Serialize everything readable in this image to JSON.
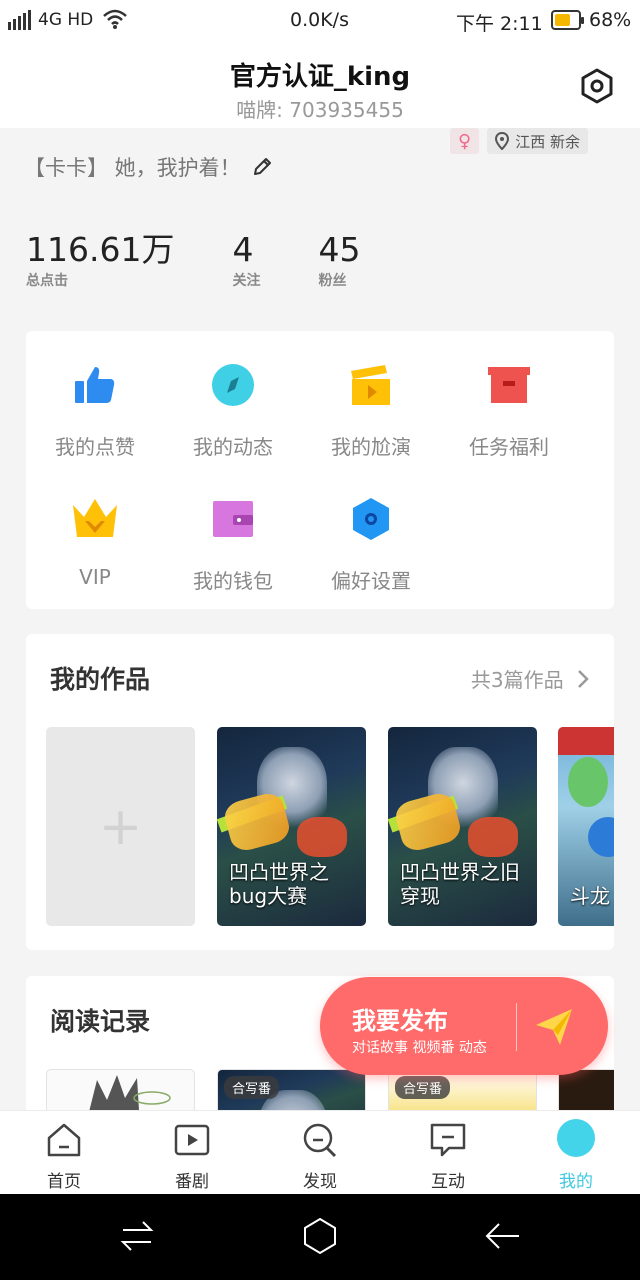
{
  "status_bar": {
    "network": "4G HD",
    "speed": "0.0K/s",
    "time": "下午 2:11",
    "battery_percent": "68%",
    "battery_level": 0.68,
    "battery_color": "#f5b800"
  },
  "header": {
    "name": "官方认证_king",
    "id_label": "喵牌: 703935455",
    "settings_icon": "hexagon-gear-icon"
  },
  "profile": {
    "gender_symbol": "♀",
    "location": "江西 新余",
    "bio": "【卡卡】 她，我护着！",
    "stats": [
      {
        "value": "116.61万",
        "label": "总点击"
      },
      {
        "value": "4",
        "label": "关注"
      },
      {
        "value": "45",
        "label": "粉丝"
      }
    ]
  },
  "menu": [
    {
      "label": "我的点赞",
      "icon": "thumbs-up-icon",
      "color": "#2e8cf0"
    },
    {
      "label": "我的动态",
      "icon": "compass-icon",
      "color": "#3fd0e6"
    },
    {
      "label": "我的尬演",
      "icon": "clapperboard-icon",
      "color": "#ffc107"
    },
    {
      "label": "任务福利",
      "icon": "gift-box-icon",
      "color": "#ef5350"
    },
    {
      "label": "VIP",
      "icon": "crown-icon",
      "color": "#ffc107"
    },
    {
      "label": "我的钱包",
      "icon": "wallet-icon",
      "color": "#d876e0"
    },
    {
      "label": "偏好设置",
      "icon": "hexagon-settings-icon",
      "color": "#2196f3"
    }
  ],
  "works": {
    "title": "我的作品",
    "count_label": "共3篇作品",
    "add_symbol": "+",
    "items": [
      {
        "caption": "凹凸世界之bug大赛"
      },
      {
        "caption": "凹凸世界之旧穿现"
      },
      {
        "caption": "斗龙"
      }
    ]
  },
  "reading": {
    "title": "阅读记录",
    "badges": [
      "合写番",
      "合写番"
    ]
  },
  "publish": {
    "title": "我要发布",
    "subtitle": "对话故事 视频番 动态",
    "color": "#ff6a6a"
  },
  "tabs": [
    {
      "label": "首页",
      "icon": "home-icon"
    },
    {
      "label": "番剧",
      "icon": "play-icon"
    },
    {
      "label": "发现",
      "icon": "search-icon"
    },
    {
      "label": "互动",
      "icon": "chat-icon"
    },
    {
      "label": "我的",
      "icon": "profile-dot-icon",
      "active": true
    }
  ]
}
